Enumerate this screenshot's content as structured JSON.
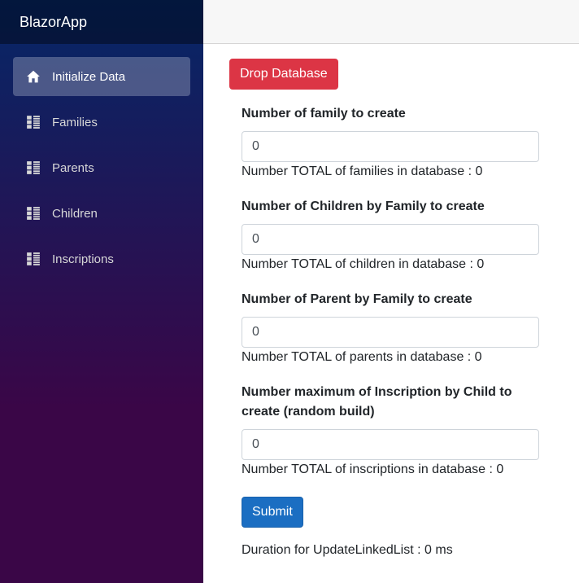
{
  "app": {
    "brand": "BlazorApp"
  },
  "sidebar": {
    "items": [
      {
        "label": "Initialize Data",
        "icon": "home-icon",
        "active": true
      },
      {
        "label": "Families",
        "icon": "list-icon",
        "active": false
      },
      {
        "label": "Parents",
        "icon": "list-icon",
        "active": false
      },
      {
        "label": "Children",
        "icon": "list-icon",
        "active": false
      },
      {
        "label": "Inscriptions",
        "icon": "list-icon",
        "active": false
      }
    ]
  },
  "main": {
    "drop_button": "Drop Database",
    "fields": [
      {
        "label": "Number of family to create",
        "value": "0",
        "total": "Number TOTAL of families in database : 0"
      },
      {
        "label": "Number of Children by Family to create",
        "value": "0",
        "total": "Number TOTAL of children in database : 0"
      },
      {
        "label": "Number of Parent by Family to create",
        "value": "0",
        "total": "Number TOTAL of parents in database : 0"
      },
      {
        "label": "Number maximum of Inscription by Child to create (random build)",
        "value": "0",
        "total": "Number TOTAL of inscriptions in database : 0"
      }
    ],
    "submit_button": "Submit",
    "duration": "Duration for UpdateLinkedList : 0 ms"
  },
  "colors": {
    "sidebar_gradient_top": "#052767",
    "sidebar_gradient_bottom": "#3a0647",
    "danger": "#dc3545",
    "primary": "#1b6ec2"
  }
}
